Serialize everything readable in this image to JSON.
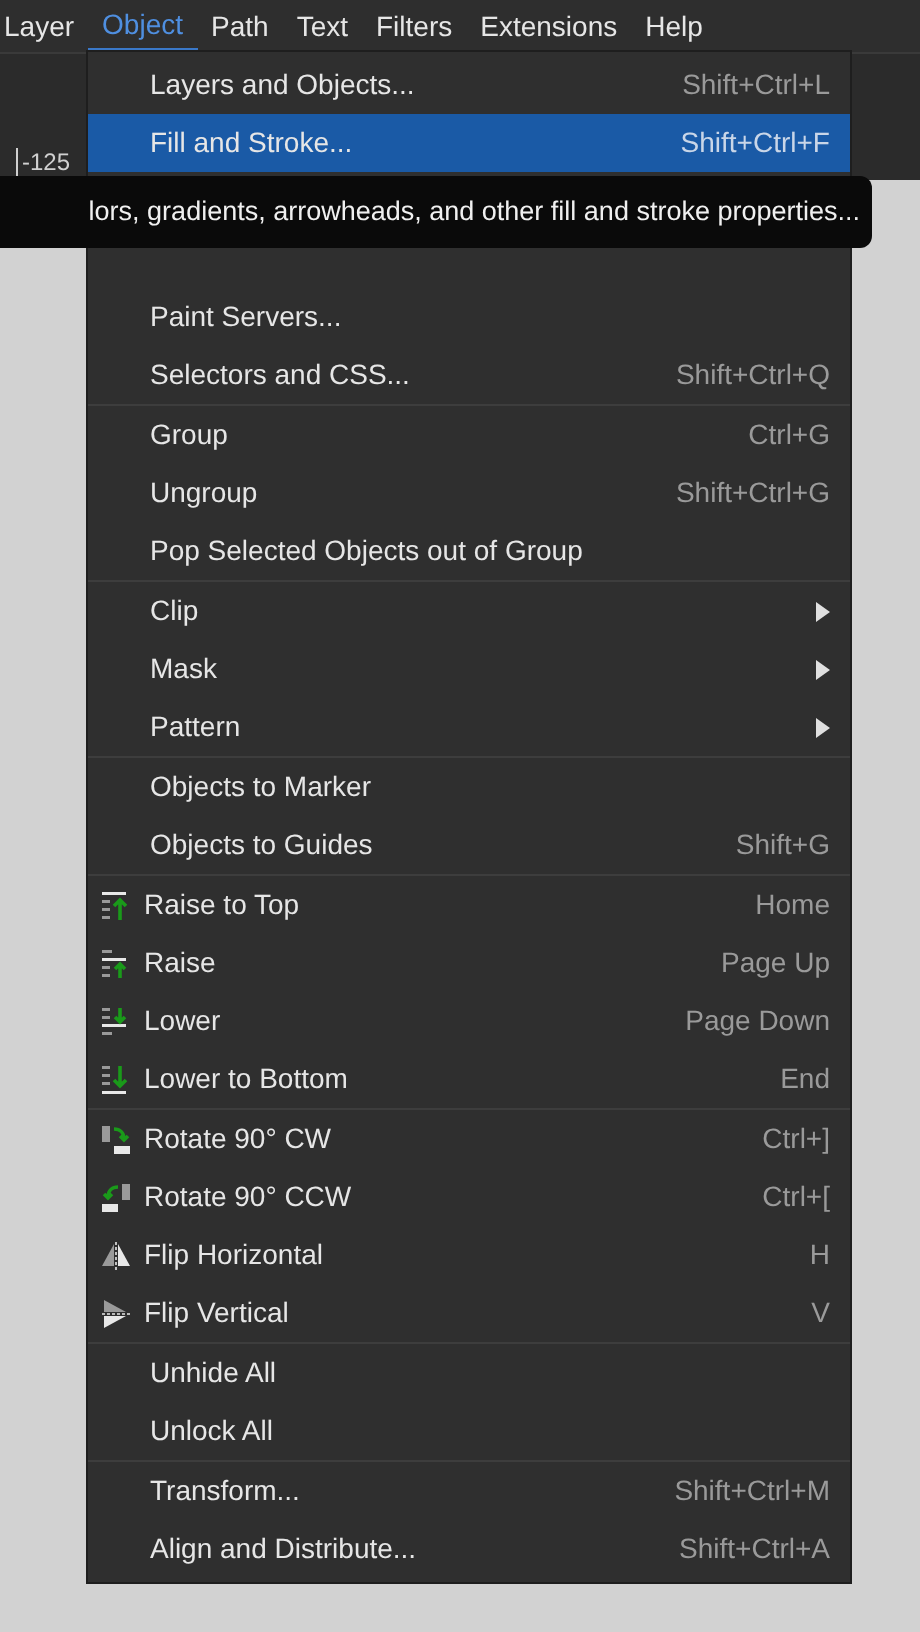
{
  "menubar": [
    {
      "label": "Layer",
      "selected": false
    },
    {
      "label": "Object",
      "selected": true
    },
    {
      "label": "Path",
      "selected": false
    },
    {
      "label": "Text",
      "selected": false
    },
    {
      "label": "Filters",
      "selected": false
    },
    {
      "label": "Extensions",
      "selected": false
    },
    {
      "label": "Help",
      "selected": false
    }
  ],
  "ruler": {
    "label": "-125"
  },
  "tooltip": {
    "text": "lors, gradients, arrowheads, and other fill and stroke properties..."
  },
  "menu": {
    "groups": [
      {
        "items": [
          {
            "label": "Layers and Objects...",
            "shortcut": "Shift+Ctrl+L",
            "selected": false
          },
          {
            "label": "Fill and Stroke...",
            "shortcut": "Shift+Ctrl+F",
            "selected": true
          }
        ]
      },
      {
        "items": [
          {
            "label": "Paint Servers...",
            "selected": false
          },
          {
            "label": "Selectors and CSS...",
            "shortcut": "Shift+Ctrl+Q",
            "selected": false
          }
        ]
      },
      {
        "items": [
          {
            "label": "Group",
            "shortcut": "Ctrl+G",
            "selected": false
          },
          {
            "label": "Ungroup",
            "shortcut": "Shift+Ctrl+G",
            "selected": false
          },
          {
            "label": "Pop Selected Objects out of Group",
            "selected": false
          }
        ]
      },
      {
        "items": [
          {
            "label": "Clip",
            "submenu": true,
            "selected": false
          },
          {
            "label": "Mask",
            "submenu": true,
            "selected": false
          },
          {
            "label": "Pattern",
            "submenu": true,
            "selected": false
          }
        ]
      },
      {
        "items": [
          {
            "label": "Objects to Marker",
            "selected": false
          },
          {
            "label": "Objects to Guides",
            "shortcut": "Shift+G",
            "selected": false
          }
        ]
      },
      {
        "items": [
          {
            "label": "Raise to Top",
            "shortcut": "Home",
            "kind": "raise-top",
            "selected": false
          },
          {
            "label": "Raise",
            "shortcut": "Page Up",
            "kind": "raise",
            "selected": false
          },
          {
            "label": "Lower",
            "shortcut": "Page Down",
            "kind": "lower",
            "selected": false
          },
          {
            "label": "Lower to Bottom",
            "shortcut": "End",
            "kind": "lower-bottom",
            "selected": false
          }
        ]
      },
      {
        "items": [
          {
            "label": "Rotate 90° CW",
            "shortcut": "Ctrl+]",
            "kind": "rotate-cw",
            "selected": false
          },
          {
            "label": "Rotate 90° CCW",
            "shortcut": "Ctrl+[",
            "kind": "rotate-ccw",
            "selected": false
          },
          {
            "label": "Flip Horizontal",
            "shortcut": "H",
            "kind": "flip-h",
            "selected": false
          },
          {
            "label": "Flip Vertical",
            "shortcut": "V",
            "kind": "flip-v",
            "selected": false
          }
        ]
      },
      {
        "items": [
          {
            "label": "Unhide All",
            "selected": false
          },
          {
            "label": "Unlock All",
            "selected": false
          }
        ]
      },
      {
        "items": [
          {
            "label": "Transform...",
            "shortcut": "Shift+Ctrl+M",
            "selected": false
          },
          {
            "label": "Align and Distribute...",
            "shortcut": "Shift+Ctrl+A",
            "selected": false
          }
        ]
      }
    ]
  }
}
